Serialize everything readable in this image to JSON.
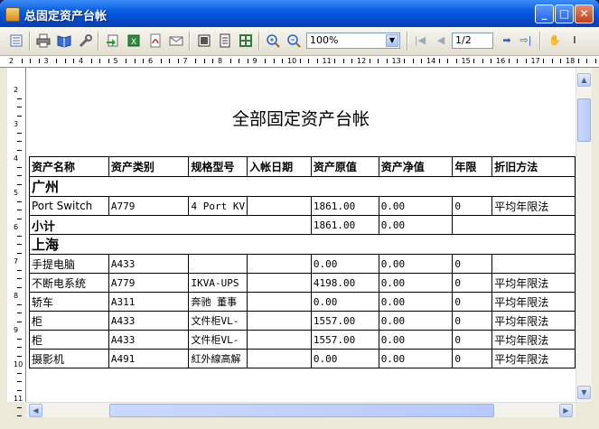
{
  "window": {
    "title": "总固定资产台帐",
    "minimize": "_",
    "maximize": "□",
    "close": "✕"
  },
  "toolbar": {
    "zoom_value": "100%",
    "page_value": "1/2"
  },
  "report": {
    "title": "全部固定资产台帐",
    "headers": [
      "资产名称",
      "资产类别",
      "规格型号",
      "入帐日期",
      "资产原值",
      "资产净值",
      "年限",
      "折旧方法"
    ],
    "sections": [
      {
        "region": "广州",
        "rows": [
          [
            "Port Switch",
            "A779",
            "4 Port KV",
            "",
            "1861.00",
            "0.00",
            "0",
            "平均年限法"
          ]
        ],
        "subtotal": {
          "label": "小计",
          "original": "1861.00",
          "net": "0.00"
        }
      },
      {
        "region": "上海",
        "rows": [
          [
            "手提电脑",
            "A433",
            "",
            "",
            "0.00",
            "0.00",
            "0",
            ""
          ],
          [
            "不断电系统",
            "A779",
            "IKVA-UPS",
            "",
            "4198.00",
            "0.00",
            "0",
            "平均年限法"
          ],
          [
            "轿车",
            "A311",
            "奔驰 董事",
            "",
            "0.00",
            "0.00",
            "0",
            "平均年限法"
          ],
          [
            "柜",
            "A433",
            "文件柜VL-",
            "",
            "1557.00",
            "0.00",
            "0",
            "平均年限法"
          ],
          [
            "柜",
            "A433",
            "文件柜VL-",
            "",
            "1557.00",
            "0.00",
            "0",
            "平均年限法"
          ],
          [
            "摄影机",
            "A491",
            "紅外線高解",
            "",
            "0.00",
            "0.00",
            "0",
            "平均年限法"
          ]
        ]
      }
    ]
  },
  "ruler_h": [
    "2",
    "3",
    "4",
    "5",
    "6",
    "7",
    "8",
    "9",
    "10",
    "11",
    "12",
    "13",
    "14",
    "15",
    "16",
    "17",
    "18"
  ],
  "ruler_v": [
    "2",
    "3",
    "4",
    "5",
    "6",
    "7",
    "8",
    "9",
    "10",
    "11"
  ]
}
